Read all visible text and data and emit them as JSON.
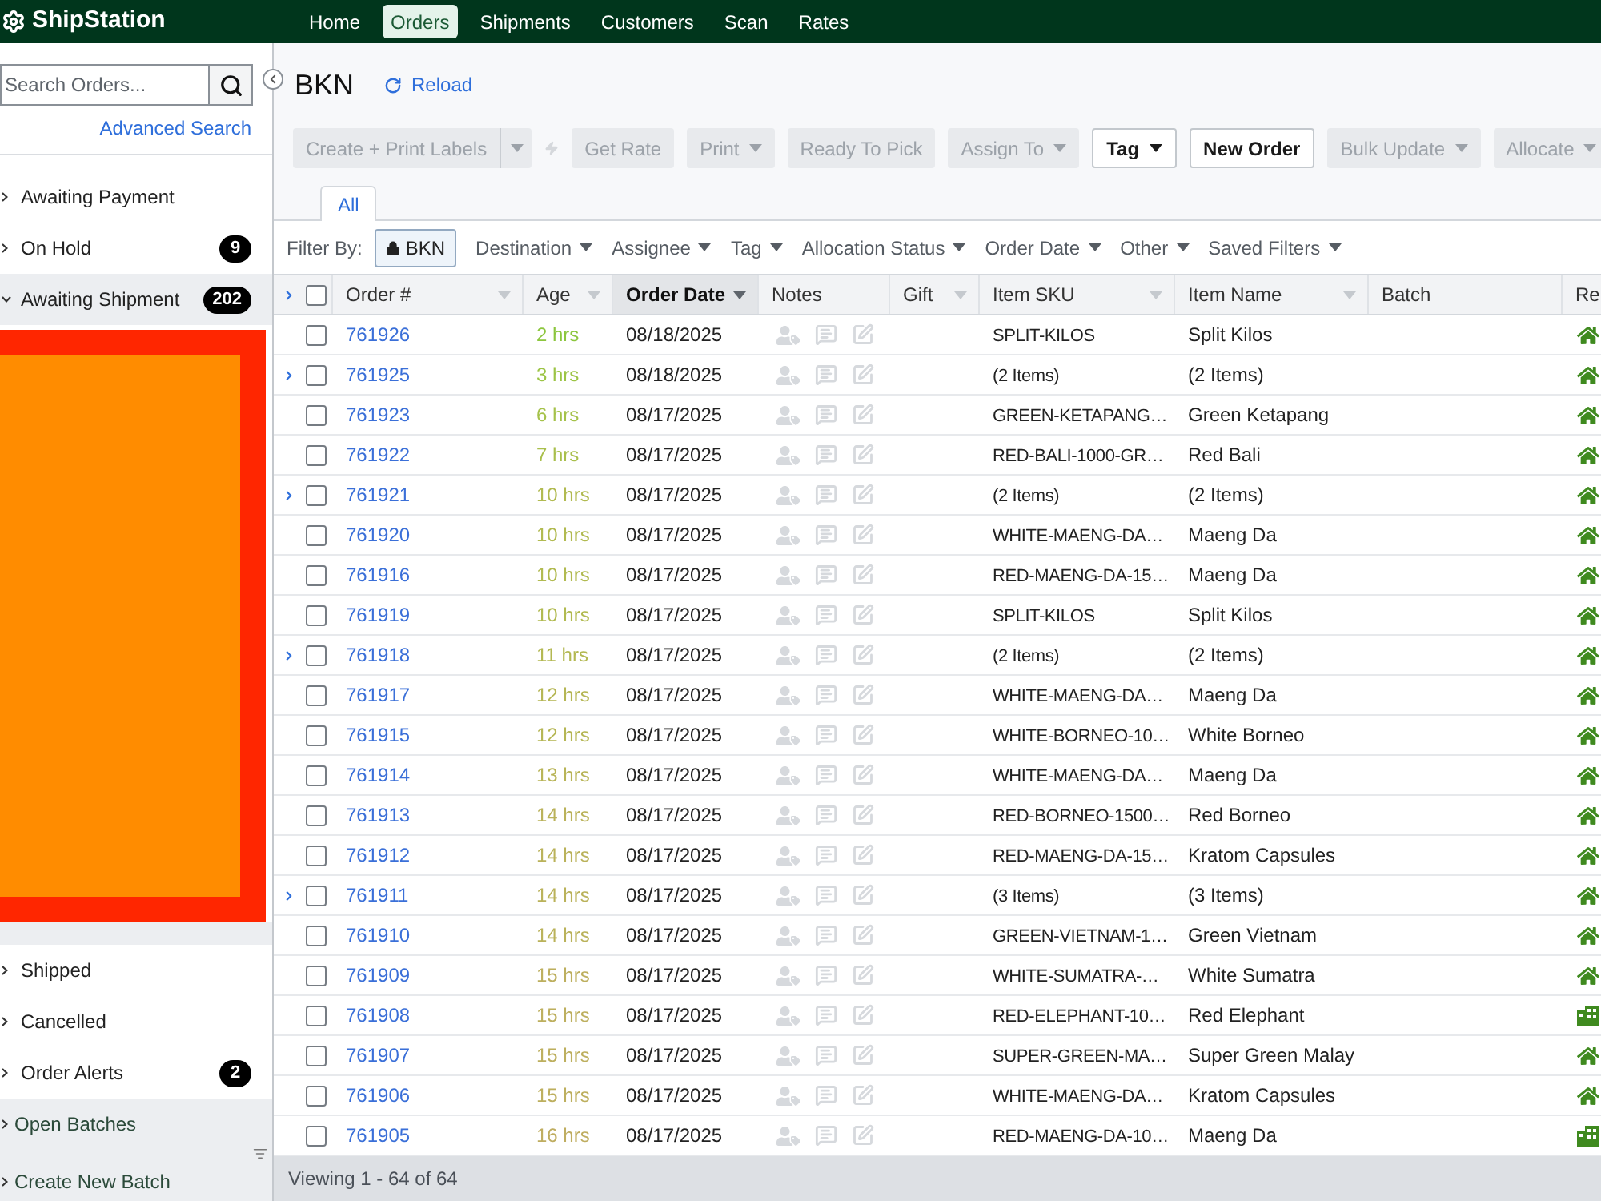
{
  "nav": {
    "logo": "ShipStation",
    "items": [
      {
        "label": "Home",
        "selected": false
      },
      {
        "label": "Orders",
        "selected": true
      },
      {
        "label": "Shipments",
        "selected": false
      },
      {
        "label": "Customers",
        "selected": false
      },
      {
        "label": "Scan",
        "selected": false
      },
      {
        "label": "Rates",
        "selected": false
      }
    ]
  },
  "sidebar": {
    "search": {
      "placeholder": "Search Orders..."
    },
    "advanced_search": "Advanced Search",
    "statuses": [
      {
        "label": "Awaiting Payment",
        "expanded": false,
        "selected": false
      },
      {
        "label": "On Hold",
        "count": "9",
        "expanded": false,
        "selected": false
      },
      {
        "label": "Awaiting Shipment",
        "count": "202",
        "expanded": true,
        "selected": true
      }
    ],
    "more_statuses": [
      {
        "label": "Shipped",
        "expanded": false,
        "selected": false
      },
      {
        "label": "Cancelled",
        "expanded": false,
        "selected": false
      },
      {
        "label": "Order Alerts",
        "count": "2",
        "expanded": false,
        "selected": false
      }
    ],
    "batches": [
      {
        "label": "Open Batches"
      },
      {
        "label": "Create New Batch"
      }
    ]
  },
  "page": {
    "title": "BKN",
    "reload": "Reload"
  },
  "toolbar": [
    {
      "label": "Create + Print Labels",
      "kind": "split",
      "disabled": true
    },
    {
      "label": "Get Rate",
      "kind": "button",
      "disabled": true
    },
    {
      "label": "Print",
      "kind": "dropdown",
      "disabled": true
    },
    {
      "label": "Ready To Pick",
      "kind": "button",
      "disabled": true
    },
    {
      "label": "Assign To",
      "kind": "dropdown",
      "disabled": true
    },
    {
      "label": "Tag",
      "kind": "dropdown",
      "disabled": false
    },
    {
      "label": "New Order",
      "kind": "button",
      "disabled": false
    },
    {
      "label": "Bulk Update",
      "kind": "dropdown",
      "disabled": true
    },
    {
      "label": "Allocate",
      "kind": "dropdown",
      "disabled": true
    }
  ],
  "tabs": [
    {
      "label": "All",
      "selected": true
    }
  ],
  "filters": {
    "label": "Filter By:",
    "chip": "BKN",
    "dropdowns": [
      "Destination",
      "Assignee",
      "Tag",
      "Allocation Status",
      "Order Date",
      "Other",
      "Saved Filters"
    ]
  },
  "table": {
    "header_checked": false,
    "columns": [
      {
        "label": "Order #",
        "sortable": true,
        "sorted": false
      },
      {
        "label": "Age",
        "sortable": true,
        "sorted": false
      },
      {
        "label": "Order Date",
        "sortable": true,
        "sorted": true
      },
      {
        "label": "Notes",
        "sortable": false,
        "sorted": false
      },
      {
        "label": "Gift",
        "sortable": true,
        "sorted": false
      },
      {
        "label": "Item SKU",
        "sortable": true,
        "sorted": false
      },
      {
        "label": "Item Name",
        "sortable": true,
        "sorted": false
      },
      {
        "label": "Batch",
        "sortable": false,
        "sorted": false
      },
      {
        "label": "Re",
        "sortable": false,
        "sorted": false
      }
    ],
    "rows": [
      {
        "kind": "residential",
        "expandable": false,
        "checked": false,
        "order": "761926",
        "age": {
          "text": "2 hrs",
          "color": "#8cc63e"
        },
        "order_date": "08/18/2025",
        "item_sku": "SPLIT-KILOS",
        "item_name": "Split Kilos"
      },
      {
        "kind": "residential",
        "expandable": true,
        "checked": false,
        "order": "761925",
        "age": {
          "text": "3 hrs",
          "color": "#9cc445"
        },
        "order_date": "08/18/2025",
        "item_sku": "(2 Items)",
        "item_name": "(2 Items)"
      },
      {
        "kind": "residential",
        "expandable": false,
        "checked": false,
        "order": "761923",
        "age": {
          "text": "6 hrs",
          "color": "#a5c24a"
        },
        "order_date": "08/17/2025",
        "item_sku": "GREEN-KETAPANG…",
        "item_name": "Green Ketapang"
      },
      {
        "kind": "residential",
        "expandable": false,
        "checked": false,
        "order": "761922",
        "age": {
          "text": "7 hrs",
          "color": "#a9bf4c"
        },
        "order_date": "08/17/2025",
        "item_sku": "RED-BALI-1000-GR…",
        "item_name": "Red Bali"
      },
      {
        "kind": "residential",
        "expandable": true,
        "checked": false,
        "order": "761921",
        "age": {
          "text": "10 hrs",
          "color": "#b1ba50"
        },
        "order_date": "08/17/2025",
        "item_sku": "(2 Items)",
        "item_name": "(2 Items)"
      },
      {
        "kind": "residential",
        "expandable": false,
        "checked": false,
        "order": "761920",
        "age": {
          "text": "10 hrs",
          "color": "#b1ba50"
        },
        "order_date": "08/17/2025",
        "item_sku": "WHITE-MAENG-DA…",
        "item_name": "Maeng Da"
      },
      {
        "kind": "residential",
        "expandable": false,
        "checked": false,
        "order": "761916",
        "age": {
          "text": "10 hrs",
          "color": "#b1ba50"
        },
        "order_date": "08/17/2025",
        "item_sku": "RED-MAENG-DA-15…",
        "item_name": "Maeng Da"
      },
      {
        "kind": "residential",
        "expandable": false,
        "checked": false,
        "order": "761919",
        "age": {
          "text": "10 hrs",
          "color": "#b1ba50"
        },
        "order_date": "08/17/2025",
        "item_sku": "SPLIT-KILOS",
        "item_name": "Split Kilos"
      },
      {
        "kind": "residential",
        "expandable": true,
        "checked": false,
        "order": "761918",
        "age": {
          "text": "11 hrs",
          "color": "#b3b852"
        },
        "order_date": "08/17/2025",
        "item_sku": "(2 Items)",
        "item_name": "(2 Items)"
      },
      {
        "kind": "residential",
        "expandable": false,
        "checked": false,
        "order": "761917",
        "age": {
          "text": "12 hrs",
          "color": "#b5b654"
        },
        "order_date": "08/17/2025",
        "item_sku": "WHITE-MAENG-DA…",
        "item_name": "Maeng Da"
      },
      {
        "kind": "residential",
        "expandable": false,
        "checked": false,
        "order": "761915",
        "age": {
          "text": "12 hrs",
          "color": "#b5b654"
        },
        "order_date": "08/17/2025",
        "item_sku": "WHITE-BORNEO-10…",
        "item_name": "White Borneo"
      },
      {
        "kind": "residential",
        "expandable": false,
        "checked": false,
        "order": "761914",
        "age": {
          "text": "13 hrs",
          "color": "#b8b457"
        },
        "order_date": "08/17/2025",
        "item_sku": "WHITE-MAENG-DA…",
        "item_name": "Maeng Da"
      },
      {
        "kind": "residential",
        "expandable": false,
        "checked": false,
        "order": "761913",
        "age": {
          "text": "14 hrs",
          "color": "#bab25a"
        },
        "order_date": "08/17/2025",
        "item_sku": "RED-BORNEO-1500…",
        "item_name": "Red Borneo"
      },
      {
        "kind": "residential",
        "expandable": false,
        "checked": false,
        "order": "761912",
        "age": {
          "text": "14 hrs",
          "color": "#bab25a"
        },
        "order_date": "08/17/2025",
        "item_sku": "RED-MAENG-DA-15…",
        "item_name": "Kratom Capsules"
      },
      {
        "kind": "residential",
        "expandable": true,
        "checked": false,
        "order": "761911",
        "age": {
          "text": "14 hrs",
          "color": "#bab25a"
        },
        "order_date": "08/17/2025",
        "item_sku": "(3 Items)",
        "item_name": "(3 Items)"
      },
      {
        "kind": "residential",
        "expandable": false,
        "checked": false,
        "order": "761910",
        "age": {
          "text": "14 hrs",
          "color": "#bab25a"
        },
        "order_date": "08/17/2025",
        "item_sku": "GREEN-VIETNAM-1…",
        "item_name": "Green Vietnam"
      },
      {
        "kind": "residential",
        "expandable": false,
        "checked": false,
        "order": "761909",
        "age": {
          "text": "15 hrs",
          "color": "#bdaf5e"
        },
        "order_date": "08/17/2025",
        "item_sku": "WHITE-SUMATRA-…",
        "item_name": "White Sumatra"
      },
      {
        "kind": "commercial",
        "expandable": false,
        "checked": false,
        "order": "761908",
        "age": {
          "text": "15 hrs",
          "color": "#bdaf5e"
        },
        "order_date": "08/17/2025",
        "item_sku": "RED-ELEPHANT-10…",
        "item_name": "Red Elephant"
      },
      {
        "kind": "residential",
        "expandable": false,
        "checked": false,
        "order": "761907",
        "age": {
          "text": "15 hrs",
          "color": "#bdaf5e"
        },
        "order_date": "08/17/2025",
        "item_sku": "SUPER-GREEN-MA…",
        "item_name": "Super Green Malay"
      },
      {
        "kind": "residential",
        "expandable": false,
        "checked": false,
        "order": "761906",
        "age": {
          "text": "15 hrs",
          "color": "#bdaf5e"
        },
        "order_date": "08/17/2025",
        "item_sku": "WHITE-MAENG-DA…",
        "item_name": "Kratom Capsules"
      },
      {
        "kind": "commercial",
        "expandable": false,
        "checked": false,
        "order": "761905",
        "age": {
          "text": "16 hrs",
          "color": "#bfad60"
        },
        "order_date": "08/17/2025",
        "item_sku": "RED-MAENG-DA-10…",
        "item_name": "Maeng Da"
      }
    ]
  },
  "footer": "Viewing 1 - 64 of 64"
}
